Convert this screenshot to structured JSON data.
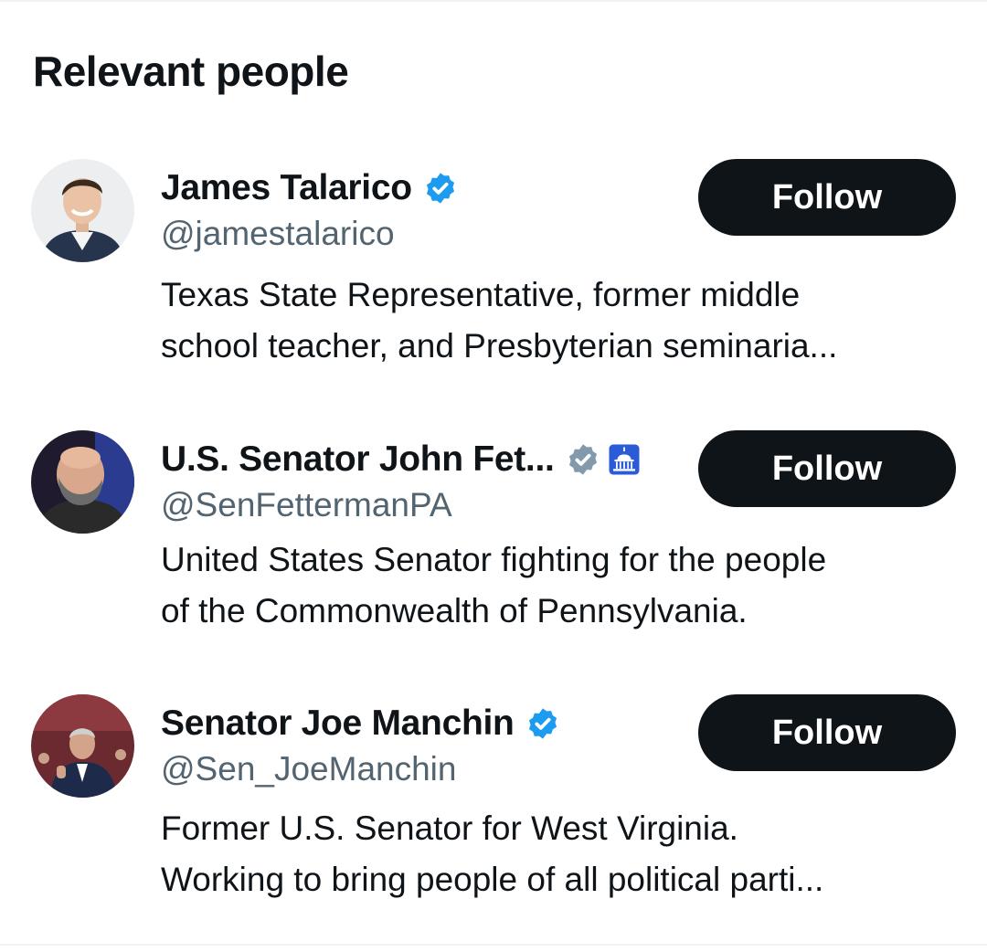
{
  "section": {
    "title": "Relevant people"
  },
  "colors": {
    "verified_blue": "#1d9bf0",
    "government_gray": "#829aab",
    "follow_button_bg": "#0f1419",
    "handle_gray": "#536471"
  },
  "people": [
    {
      "name": "James Talarico",
      "handle": "@jamestalarico",
      "badges": [
        "verified-blue-icon"
      ],
      "bio_lines": [
        "Texas State Representative, former middle",
        "school teacher, and Presbyterian seminaria..."
      ],
      "follow_label": "Follow"
    },
    {
      "name": "U.S. Senator John Fet...",
      "handle": "@SenFettermanPA",
      "badges": [
        "verified-gray-icon",
        "us-senate-capitol-icon"
      ],
      "bio_lines": [
        "United States Senator fighting for the people",
        "of the Commonwealth of Pennsylvania."
      ],
      "follow_label": "Follow"
    },
    {
      "name": "Senator Joe Manchin",
      "handle": "@Sen_JoeManchin",
      "badges": [
        "verified-blue-icon"
      ],
      "bio_lines": [
        "Former U.S. Senator for West Virginia.",
        "Working to bring people of all political parti..."
      ],
      "follow_label": "Follow"
    }
  ]
}
